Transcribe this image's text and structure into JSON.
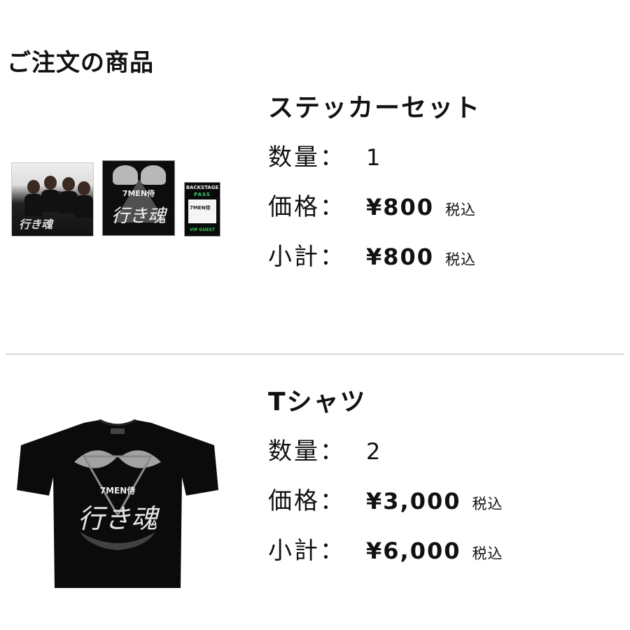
{
  "section_title": "ご注文の商品",
  "items": [
    {
      "name": "ステッカーセット",
      "quantity_label": "数量：",
      "quantity": "1",
      "price_label": "価格：",
      "price": "¥800",
      "price_tax": "税込",
      "subtotal_label": "小計：",
      "subtotal": "¥800",
      "subtotal_tax": "税込",
      "image": {
        "photo_logo": "行き魂",
        "sticker_name": "7MEN侍",
        "sticker_kanji": "行き魂",
        "pass_title": "BACKSTAGE",
        "pass_subtitle": "PASS",
        "pass_card_text": "7MEN侍",
        "pass_footer": "VIP GUEST"
      }
    },
    {
      "name": "Tシャツ",
      "quantity_label": "数量：",
      "quantity": "2",
      "price_label": "価格：",
      "price": "¥3,000",
      "price_tax": "税込",
      "subtotal_label": "小計：",
      "subtotal": "¥6,000",
      "subtotal_tax": "税込",
      "image": {
        "shirt_name": "7MEN侍",
        "shirt_kanji": "行き魂"
      }
    }
  ],
  "colors": {
    "text": "#111111",
    "divider": "#d6d6d6",
    "pass_accent": "#3ed36a"
  }
}
